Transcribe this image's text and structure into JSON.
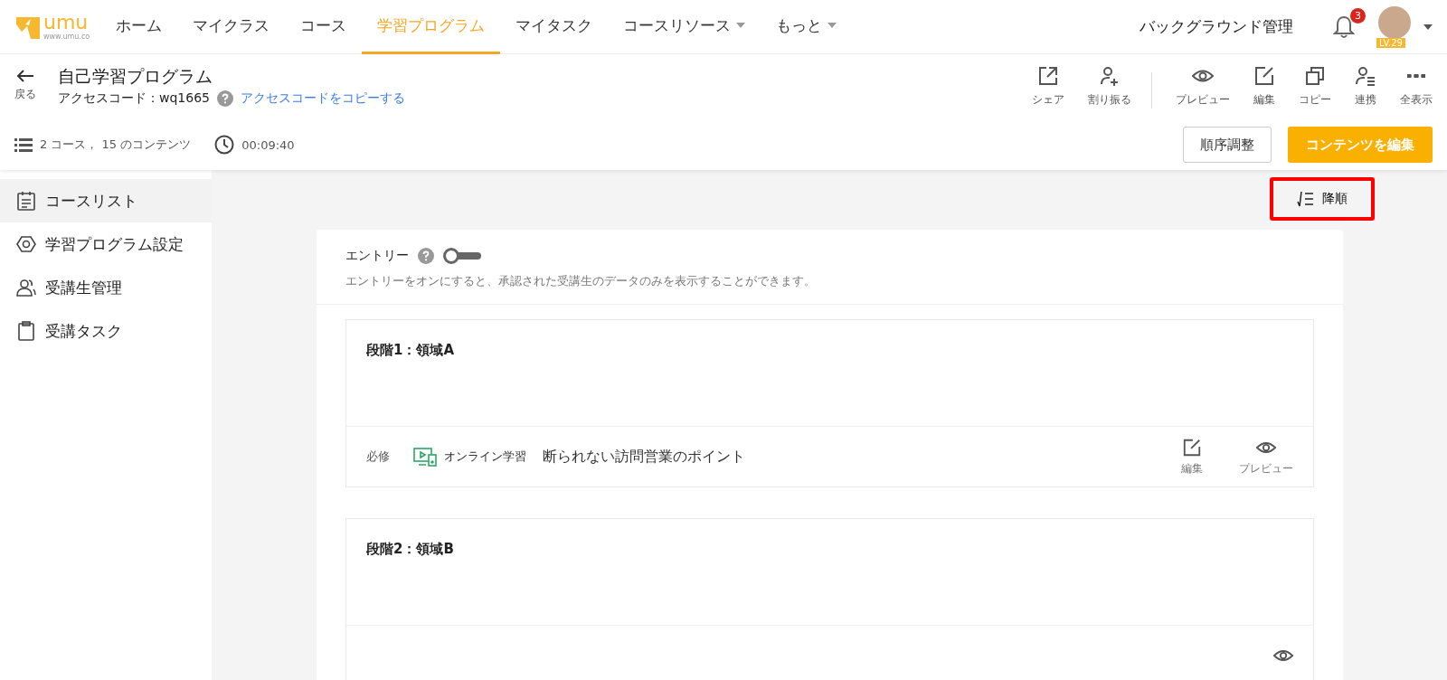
{
  "logo": {
    "text": "umu",
    "url": "www.umu.co"
  },
  "nav": [
    {
      "label": "ホーム",
      "selected": false,
      "dropdown": false
    },
    {
      "label": "マイクラス",
      "selected": false,
      "dropdown": false
    },
    {
      "label": "コース",
      "selected": false,
      "dropdown": false
    },
    {
      "label": "学習プログラム",
      "selected": true,
      "dropdown": false
    },
    {
      "label": "マイタスク",
      "selected": false,
      "dropdown": false
    },
    {
      "label": "コースリソース",
      "selected": false,
      "dropdown": true
    },
    {
      "label": "もっと",
      "selected": false,
      "dropdown": true
    }
  ],
  "admin_link": "バックグラウンド管理",
  "notifications": {
    "count": "3"
  },
  "user": {
    "level": "LV.29"
  },
  "header": {
    "back": "戻る",
    "title": "自己学習プログラム",
    "access_code": "アクセスコード：wq1665",
    "copy_link": "アクセスコードをコピーする",
    "stats": "2 コース，  15 のコンテンツ",
    "duration": "00:09:40"
  },
  "actions": [
    {
      "kind": "share",
      "label": "シェア"
    },
    {
      "kind": "assign",
      "label": "割り振る"
    },
    {
      "kind": "divider"
    },
    {
      "kind": "preview",
      "label": "プレビュー"
    },
    {
      "kind": "edit",
      "label": "編集"
    },
    {
      "kind": "copy",
      "label": "コピー"
    },
    {
      "kind": "link",
      "label": "連携"
    },
    {
      "kind": "more",
      "label": "全表示"
    }
  ],
  "buttons": {
    "reorder": "順序調整",
    "edit_content": "コンテンツを編集"
  },
  "sidebar": [
    {
      "kind": "list",
      "label": "コースリスト",
      "selected": true
    },
    {
      "kind": "settings",
      "label": "学習プログラム設定",
      "selected": false
    },
    {
      "kind": "users",
      "label": "受講生管理",
      "selected": false
    },
    {
      "kind": "task",
      "label": "受講タスク",
      "selected": false
    }
  ],
  "sort": {
    "label": "降順",
    "highlighted": true
  },
  "entry": {
    "label": "エントリー",
    "on": false,
    "description": "エントリーをオンにすると、承認された受講生のデータのみを表示することができます。"
  },
  "stages": [
    {
      "title": "段階1：領域A",
      "items": [
        {
          "tag": "必修",
          "type": "オンライン学習",
          "title": "断られない訪問営業のポイント",
          "actions": [
            {
              "kind": "edit",
              "label": "編集"
            },
            {
              "kind": "preview",
              "label": "プレビュー"
            }
          ]
        }
      ]
    },
    {
      "title": "段階2：領域B",
      "items": [
        {
          "actions": [
            {
              "kind": "preview"
            }
          ]
        }
      ]
    }
  ]
}
